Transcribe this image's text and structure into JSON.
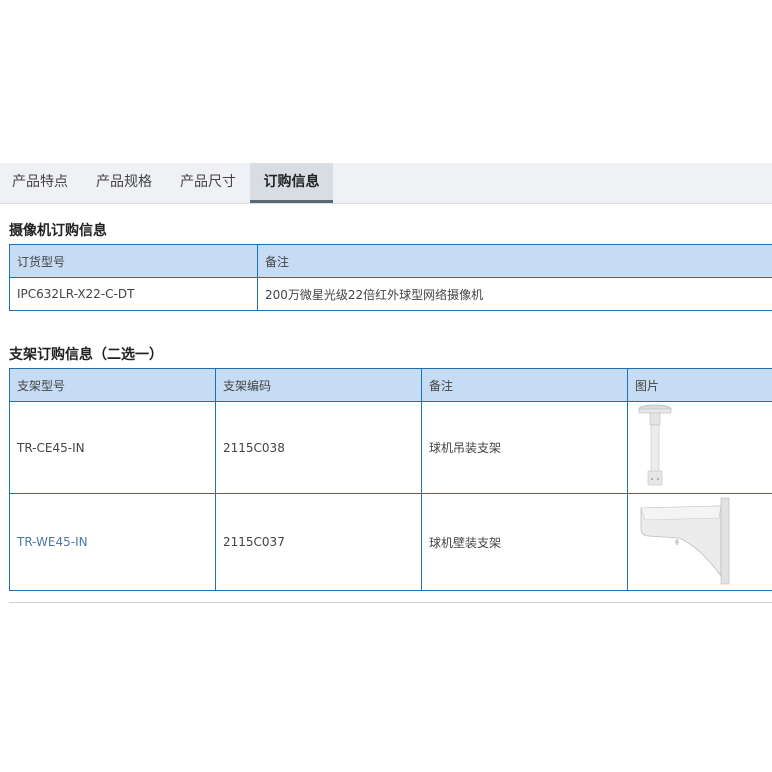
{
  "tabs": [
    {
      "label": "产品特点",
      "active": false
    },
    {
      "label": "产品规格",
      "active": false
    },
    {
      "label": "产品尺寸",
      "active": false
    },
    {
      "label": "订购信息",
      "active": true
    }
  ],
  "camera_section": {
    "title": "摄像机订购信息",
    "headers": [
      "订货型号",
      "备注"
    ],
    "rows": [
      {
        "model": "IPC632LR-X22-C-DT",
        "note": "200万微星光级22倍红外球型网络摄像机"
      }
    ]
  },
  "bracket_section": {
    "title": "支架订购信息（二选一）",
    "headers": [
      "支架型号",
      "支架编码",
      "备注",
      "图片"
    ],
    "rows": [
      {
        "model": "TR-CE45-IN",
        "code": "2115C038",
        "note": "球机吊装支架",
        "image": "pendant-mount-bracket-image"
      },
      {
        "model": "TR-WE45-IN",
        "code": "2115C037",
        "note": "球机壁装支架",
        "image": "wall-mount-bracket-image"
      }
    ]
  },
  "colors": {
    "tab_bar_bg": "#eff1f4",
    "active_tab_bg": "#d8dde4",
    "active_tab_underline": "#5b6876",
    "table_border": "#1f6fb4",
    "header_bg": "#c6dcf4",
    "link": "#4a79a8"
  }
}
